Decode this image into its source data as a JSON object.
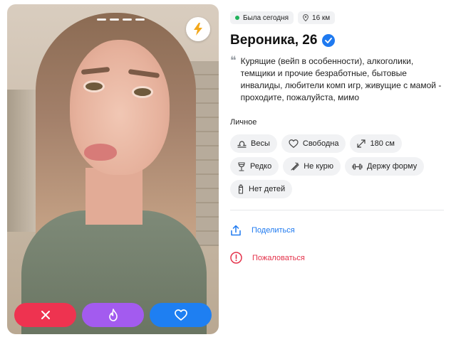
{
  "profile": {
    "status_online": "Была сегодня",
    "distance": "16 км",
    "name_age": "Вероника, 26",
    "bio": "Курящие (вейп в особенности), алкоголики, темщики и прочие безработные, бытовые инвалиды, любители комп игр, живущие с мамой - проходите, пожалуйста, мимо",
    "quote_mark": "❝"
  },
  "personal": {
    "title": "Личное",
    "tags": [
      {
        "icon": "zodiac-icon",
        "label": "Весы"
      },
      {
        "icon": "heart-outline-icon",
        "label": "Свободна"
      },
      {
        "icon": "height-icon",
        "label": "180 см"
      },
      {
        "icon": "wine-glass-icon",
        "label": "Редко"
      },
      {
        "icon": "no-smoking-icon",
        "label": "Не курю"
      },
      {
        "icon": "dumbbell-icon",
        "label": "Держу форму"
      },
      {
        "icon": "baby-bottle-icon",
        "label": "Нет детей"
      }
    ]
  },
  "links": {
    "share": "Поделиться",
    "report": "Пожаловаться"
  },
  "colors": {
    "accent_blue": "#1f7af0",
    "reject_red": "#ee3350",
    "superlike_purple": "#a35bef",
    "online_green": "#21b25b",
    "report_red": "#e4334b"
  },
  "photo": {
    "progress_segments": 4,
    "active_segment": 1
  }
}
